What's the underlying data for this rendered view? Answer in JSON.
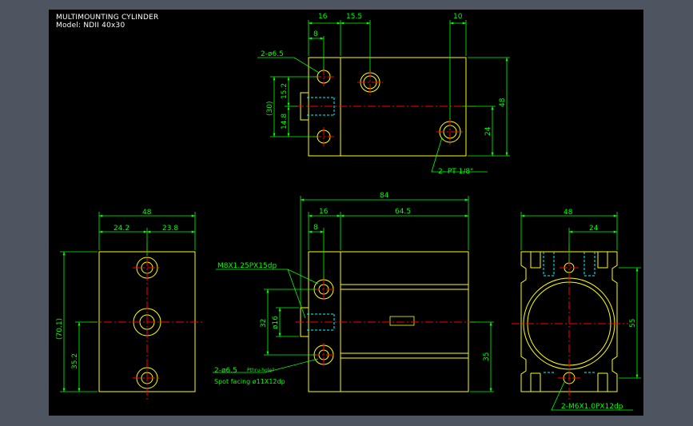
{
  "title": {
    "line1": "MULTIMOUNTING CYLINDER",
    "line2": "Model: NDII 40x30"
  },
  "dimensions": {
    "top_16": "16",
    "top_15_5": "15.5",
    "top_10": "10",
    "top_8": "8",
    "top_hole_2_6_5": "2-ø6.5",
    "top_30": "(30)",
    "top_15_2": "15.2",
    "top_14_8": "14.8",
    "top_48": "48",
    "top_24": "24",
    "top_pt": "2- PT 1/8\"",
    "front_84": "84",
    "front_16": "16",
    "front_64_5": "64.5",
    "front_8": "8",
    "front_m8": "M8X1.25PX15dp",
    "front_32": "32",
    "front_d16": "ø16",
    "front_35": "35",
    "front_hole_a": "2-ø6.5",
    "front_hole_b": "Pthru-hole?",
    "front_spot": "Spot facing  ø11X12dp",
    "left_48": "48",
    "left_24_2": "24.2",
    "left_23_8": "23.8",
    "left_70_1": "(70.1)",
    "left_35_2": "35.2",
    "right_48": "48",
    "right_24": "24",
    "right_55": "55",
    "right_m6": "2-M6X1.0PX12dp"
  },
  "colors": {
    "background": "#000000",
    "frame": "#4e5561",
    "outline": "#ffff00",
    "dimension": "#00ff00",
    "centerline": "#ff0000",
    "hidden": "#00ffff",
    "text": "#ffffff"
  }
}
